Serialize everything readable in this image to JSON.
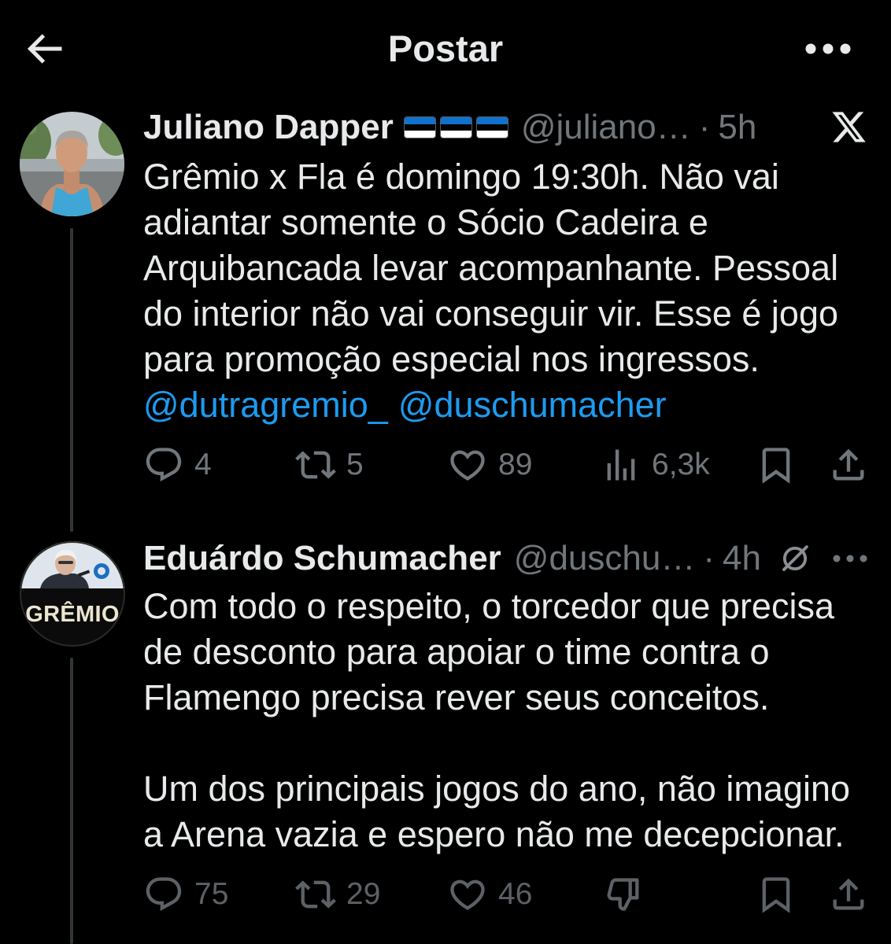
{
  "header": {
    "title": "Postar",
    "back_icon": "arrow-left-icon",
    "more_icon": "more-horizontal-icon"
  },
  "colors": {
    "background": "#000000",
    "text": "#e7e9ea",
    "secondary": "#71767b",
    "link": "#1d9bf0",
    "thread_line": "#333639",
    "flag_stripes": [
      "#0f72ce",
      "#000000",
      "#ffffff"
    ]
  },
  "posts": [
    {
      "author": {
        "name": "Juliano Dapper",
        "name_emoji": [
          "flag-estonia-icon",
          "flag-estonia-icon",
          "flag-estonia-icon"
        ],
        "handle": "@juliano…"
      },
      "separator": "·",
      "time": "5h",
      "badge_icon": "x-logo-icon",
      "text_lines": [
        "Grêmio x Fla é domingo 19:30h. Não vai",
        "adiantar somente o Sócio Cadeira e",
        "Arquibancada levar acompanhante. Pessoal",
        "do interior não vai conseguir vir. Esse é jogo",
        "para promoção especial nos ingressos."
      ],
      "mentions": [
        "@dutragremio_",
        "@duschumacher"
      ],
      "actions": {
        "replies": {
          "icon": "reply-icon",
          "count": "4"
        },
        "reposts": {
          "icon": "repost-icon",
          "count": "5"
        },
        "likes": {
          "icon": "heart-icon",
          "count": "89"
        },
        "views": {
          "icon": "views-icon",
          "count": "6,3k"
        },
        "bookmark": {
          "icon": "bookmark-icon"
        },
        "share": {
          "icon": "share-icon"
        }
      }
    },
    {
      "author": {
        "name": "Eduárdo Schumacher",
        "handle": "@duschu…",
        "avatar_text": "GRÊMIO"
      },
      "separator": "·",
      "time": "4h",
      "menu_icons": [
        "grok-icon",
        "more-horizontal-icon"
      ],
      "paragraphs": [
        [
          "Com todo o respeito, o torcedor que precisa",
          "de desconto para apoiar o time contra o",
          "Flamengo precisa rever seus conceitos."
        ],
        [
          "Um dos principais jogos do ano, não imagino",
          "a Arena vazia e espero não me decepcionar."
        ]
      ],
      "actions": {
        "replies": {
          "icon": "reply-icon",
          "count": "75"
        },
        "reposts": {
          "icon": "repost-icon",
          "count": "29"
        },
        "likes": {
          "icon": "heart-icon",
          "count": "46"
        },
        "downvote": {
          "icon": "thumbs-down-icon"
        },
        "bookmark": {
          "icon": "bookmark-icon"
        },
        "share": {
          "icon": "share-icon"
        }
      }
    }
  ]
}
